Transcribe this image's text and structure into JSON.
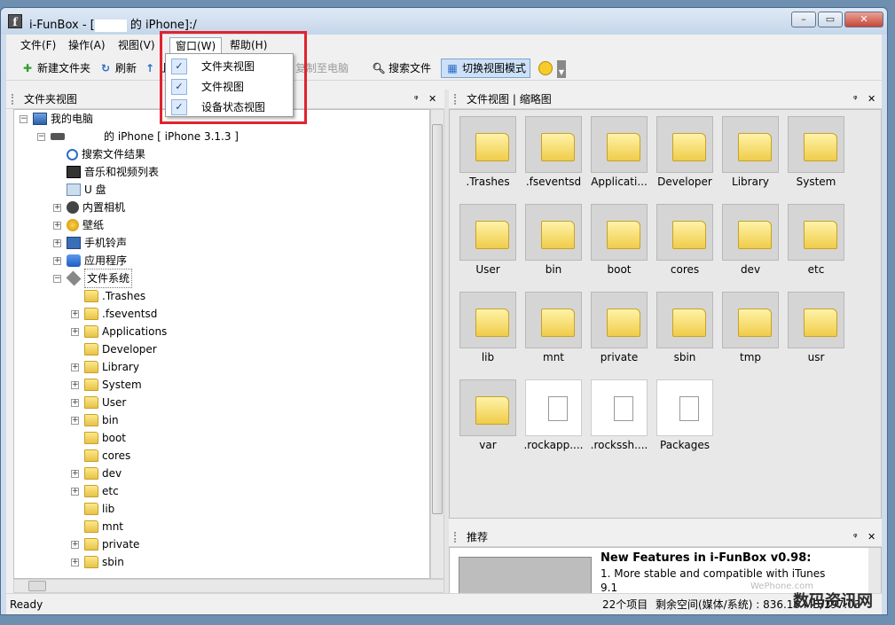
{
  "window": {
    "title_prefix": "i-FunBox - [",
    "title_suffix": " 的 iPhone]:/",
    "app_icon": "f",
    "buttons": {
      "minimize": "–",
      "maximize": "▭",
      "close": "✕"
    }
  },
  "menu": {
    "items": [
      "文件(F)",
      "操作(A)",
      "视图(V)",
      "窗口(W)",
      "帮助(H)"
    ]
  },
  "window_menu": {
    "items": [
      {
        "label": "文件夹视图",
        "checked": "✓"
      },
      {
        "label": "文件视图",
        "checked": "✓"
      },
      {
        "label": "设备状态视图",
        "checked": "✓"
      }
    ]
  },
  "toolbar": {
    "new_folder": "新建文件夹",
    "refresh": "刷新",
    "upload": "上",
    "copy_to_pc": "复制至电脑",
    "search": "搜索文件",
    "switch_view": "切换视图模式"
  },
  "left_panel": {
    "title": "文件夹视图",
    "pin": "ᵠ",
    "close": "✕"
  },
  "tree": [
    {
      "label": "我的电脑",
      "icon": "computer-icon"
    },
    {
      "label": "的 iPhone  [ iPhone 3.1.3 ]",
      "icon": "phone-icon"
    },
    {
      "label": "搜索文件结果",
      "icon": "search-icon"
    },
    {
      "label": "音乐和视频列表",
      "icon": "film-icon"
    },
    {
      "label": "U 盘",
      "icon": "drive-icon"
    },
    {
      "label": "内置相机",
      "icon": "camera-icon"
    },
    {
      "label": "壁纸",
      "icon": "sun-icon"
    },
    {
      "label": "手机铃声",
      "icon": "speaker-icon"
    },
    {
      "label": "应用程序",
      "icon": "apps-icon"
    },
    {
      "label": "文件系统",
      "icon": "filesystem-icon"
    },
    {
      "label": ".Trashes",
      "icon": "folder-icon"
    },
    {
      "label": ".fseventsd",
      "icon": "folder-icon"
    },
    {
      "label": "Applications",
      "icon": "folder-icon"
    },
    {
      "label": "Developer",
      "icon": "folder-icon"
    },
    {
      "label": "Library",
      "icon": "folder-icon"
    },
    {
      "label": "System",
      "icon": "folder-icon"
    },
    {
      "label": "User",
      "icon": "folder-icon"
    },
    {
      "label": "bin",
      "icon": "folder-icon"
    },
    {
      "label": "boot",
      "icon": "folder-icon"
    },
    {
      "label": "cores",
      "icon": "folder-icon"
    },
    {
      "label": "dev",
      "icon": "folder-icon"
    },
    {
      "label": "etc",
      "icon": "folder-icon"
    },
    {
      "label": "lib",
      "icon": "folder-icon"
    },
    {
      "label": "mnt",
      "icon": "folder-icon"
    },
    {
      "label": "private",
      "icon": "folder-icon"
    },
    {
      "label": "sbin",
      "icon": "folder-icon"
    }
  ],
  "right_panel": {
    "title": "文件视图",
    "separator": "|",
    "title2": "缩略图",
    "pin": "ᵠ",
    "close": "✕"
  },
  "files": [
    ".Trashes",
    ".fseventsd",
    "Applicati...",
    "Developer",
    "Library",
    "System",
    "User",
    "bin",
    "boot",
    "cores",
    "dev",
    "etc",
    "lib",
    "mnt",
    "private",
    "sbin",
    "tmp",
    "usr",
    "var",
    ".rockapp....",
    ".rockssh....",
    "Packages"
  ],
  "recommend": {
    "title": "推荐",
    "heading": "New Features in i-FunBox v0.98:",
    "line1": "1. More stable and compatible with iTunes",
    "line2": "9.1"
  },
  "status": {
    "ready": "Ready",
    "count": "22个项目",
    "space": "剩余空间(媒体/系统) : 836.16 MB/197.03"
  },
  "watermark": {
    "text": "数码资讯网",
    "site": "WePhone.com"
  }
}
